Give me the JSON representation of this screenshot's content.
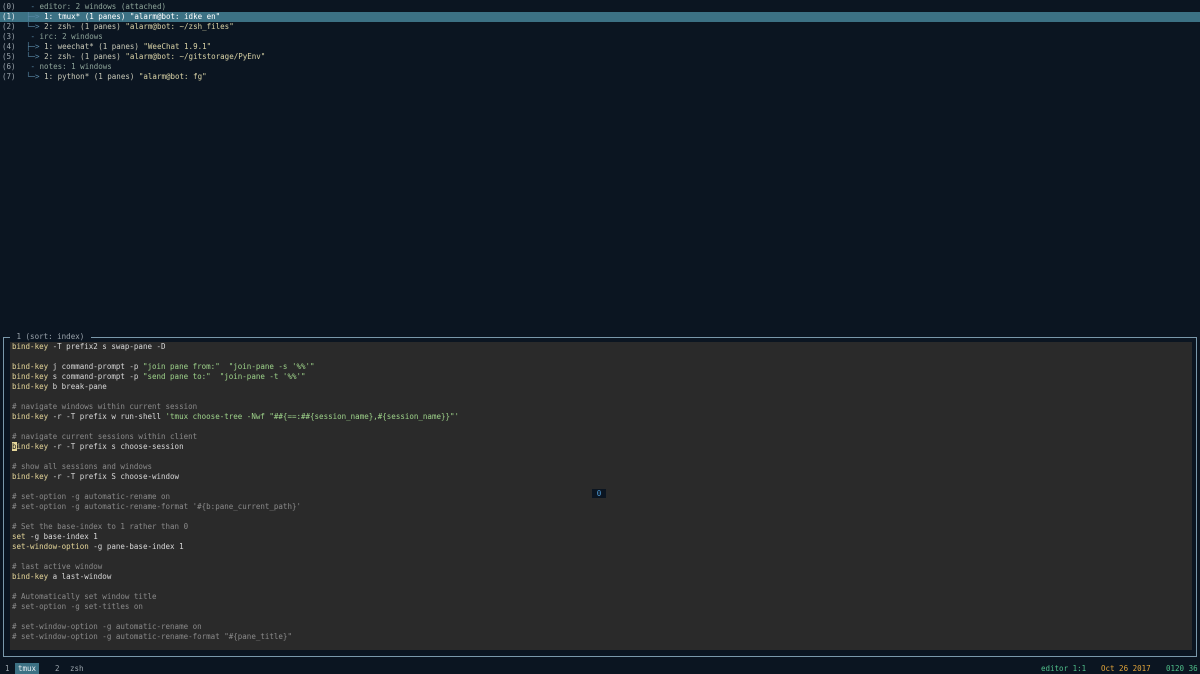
{
  "tree": {
    "rows": [
      {
        "idx": "(0)",
        "line": " - ",
        "name": "editor: 2 windows (attached)",
        "title": "",
        "type": "session"
      },
      {
        "idx": "(1)",
        "line": "├─> ",
        "name": "1: tmux* (1 panes) ",
        "title": "\"alarm@bot: idke en\"",
        "type": "window",
        "selected": true
      },
      {
        "idx": "(2)",
        "line": "└─> ",
        "name": "2: zsh- (1 panes) ",
        "title": "\"alarm@bot: ~/zsh_files\"",
        "type": "window"
      },
      {
        "idx": "(3)",
        "line": " - ",
        "name": "irc: 2 windows",
        "title": "",
        "type": "session"
      },
      {
        "idx": "(4)",
        "line": "├─> ",
        "name": "1: weechat* (1 panes) ",
        "title": "\"WeeChat 1.9.1\"",
        "type": "window"
      },
      {
        "idx": "(5)",
        "line": "└─> ",
        "name": "2: zsh- (1 panes) ",
        "title": "\"alarm@bot: ~/gitstorage/PyEnv\"",
        "type": "window"
      },
      {
        "idx": "(6)",
        "line": " - ",
        "name": "notes: 1 windows",
        "title": "",
        "type": "session"
      },
      {
        "idx": "(7)",
        "line": "└─> ",
        "name": "1: python* (1 panes) ",
        "title": "\"alarm@bot: fg\"",
        "type": "window"
      }
    ]
  },
  "preview": {
    "label": " 1 (sort: index) ",
    "pane_number": "0",
    "lines": [
      [
        {
          "t": "bind-key",
          "c": "kw"
        },
        {
          "t": " -T prefix2 s swap-pane -D",
          "c": "pl"
        }
      ],
      [],
      [
        {
          "t": "bind-key",
          "c": "kw"
        },
        {
          "t": " j command-prompt -p ",
          "c": "pl"
        },
        {
          "t": "\"join pane from:\"  \"join-pane -s '%%'\"",
          "c": "str"
        }
      ],
      [
        {
          "t": "bind-key",
          "c": "kw"
        },
        {
          "t": " s command-prompt -p ",
          "c": "pl"
        },
        {
          "t": "\"send pane to:\"  \"join-pane -t '%%'\"",
          "c": "str"
        }
      ],
      [
        {
          "t": "bind-key",
          "c": "kw"
        },
        {
          "t": " b break-pane",
          "c": "pl"
        }
      ],
      [],
      [
        {
          "t": "# navigate windows within current session",
          "c": "cm"
        }
      ],
      [
        {
          "t": "bind-key",
          "c": "kw"
        },
        {
          "t": " -r -T prefix w run-shell ",
          "c": "pl"
        },
        {
          "t": "'tmux choose-tree -Nwf \"##{==:##{session_name},#{session_name}}\"'",
          "c": "str"
        }
      ],
      [],
      [
        {
          "t": "# navigate current sessions within client",
          "c": "cm"
        }
      ],
      [
        {
          "t": "b",
          "c": "cursor"
        },
        {
          "t": "ind-key",
          "c": "kw"
        },
        {
          "t": " -r -T prefix s choose-session",
          "c": "pl"
        }
      ],
      [],
      [
        {
          "t": "# show all sessions and windows",
          "c": "cm"
        }
      ],
      [
        {
          "t": "bind-key",
          "c": "kw"
        },
        {
          "t": " -r -T prefix S choose-window",
          "c": "pl"
        }
      ],
      [],
      [
        {
          "t": "# set-option -g automatic-rename on",
          "c": "cm"
        }
      ],
      [
        {
          "t": "# set-option -g automatic-rename-format '#{b:pane_current_path}'",
          "c": "cm"
        }
      ],
      [],
      [
        {
          "t": "# Set the base-index to 1 rather than 0",
          "c": "cm"
        }
      ],
      [
        {
          "t": "set",
          "c": "kw"
        },
        {
          "t": " -g base-index 1",
          "c": "pl"
        }
      ],
      [
        {
          "t": "set-window-option",
          "c": "kw"
        },
        {
          "t": " -g pane-base-index 1",
          "c": "pl"
        }
      ],
      [],
      [
        {
          "t": "# last active window",
          "c": "cm"
        }
      ],
      [
        {
          "t": "bind-key",
          "c": "kw"
        },
        {
          "t": " a last-window",
          "c": "pl"
        }
      ],
      [],
      [
        {
          "t": "# Automatically set window title",
          "c": "cm"
        }
      ],
      [
        {
          "t": "# set-option -g set-titles on",
          "c": "cm"
        }
      ],
      [],
      [
        {
          "t": "# set-window-option -g automatic-rename on",
          "c": "cm"
        }
      ],
      [
        {
          "t": "# set-window-option -g automatic-rename-format \"#{pane_title}\"",
          "c": "cm"
        }
      ]
    ]
  },
  "status": {
    "windows": [
      {
        "index": "1",
        "name": "tmux",
        "active": true
      },
      {
        "index": "2",
        "name": "zsh",
        "active": false
      }
    ],
    "session": "editor 1:1",
    "date": "Oct 26 2017",
    "time": "0120 36"
  }
}
